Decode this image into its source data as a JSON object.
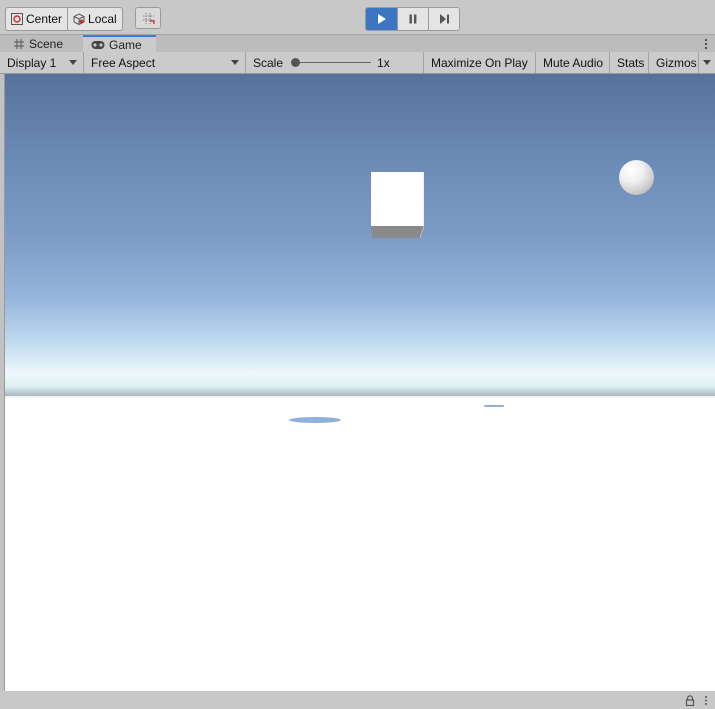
{
  "toolbar": {
    "pivot_label": "Center",
    "space_label": "Local",
    "snap_icon": "grid-snap-icon",
    "play_state": "playing",
    "colors": {
      "play_active": "#3c75c1"
    }
  },
  "tabs": [
    {
      "label": "Scene",
      "icon": "hash-icon",
      "active": false
    },
    {
      "label": "Game",
      "icon": "gamepad-icon",
      "active": true
    }
  ],
  "gamebar": {
    "display": "Display 1",
    "aspect": "Free Aspect",
    "scale_label": "Scale",
    "scale_value": "1x",
    "maximize": "Maximize On Play",
    "mute": "Mute Audio",
    "stats": "Stats",
    "gizmos": "Gizmos"
  },
  "viewport": {
    "objects": [
      "cube",
      "sphere"
    ],
    "colors": {
      "sky_top": "#56729c",
      "horizon": "#eef8fb",
      "ground": "#ffffff"
    }
  }
}
